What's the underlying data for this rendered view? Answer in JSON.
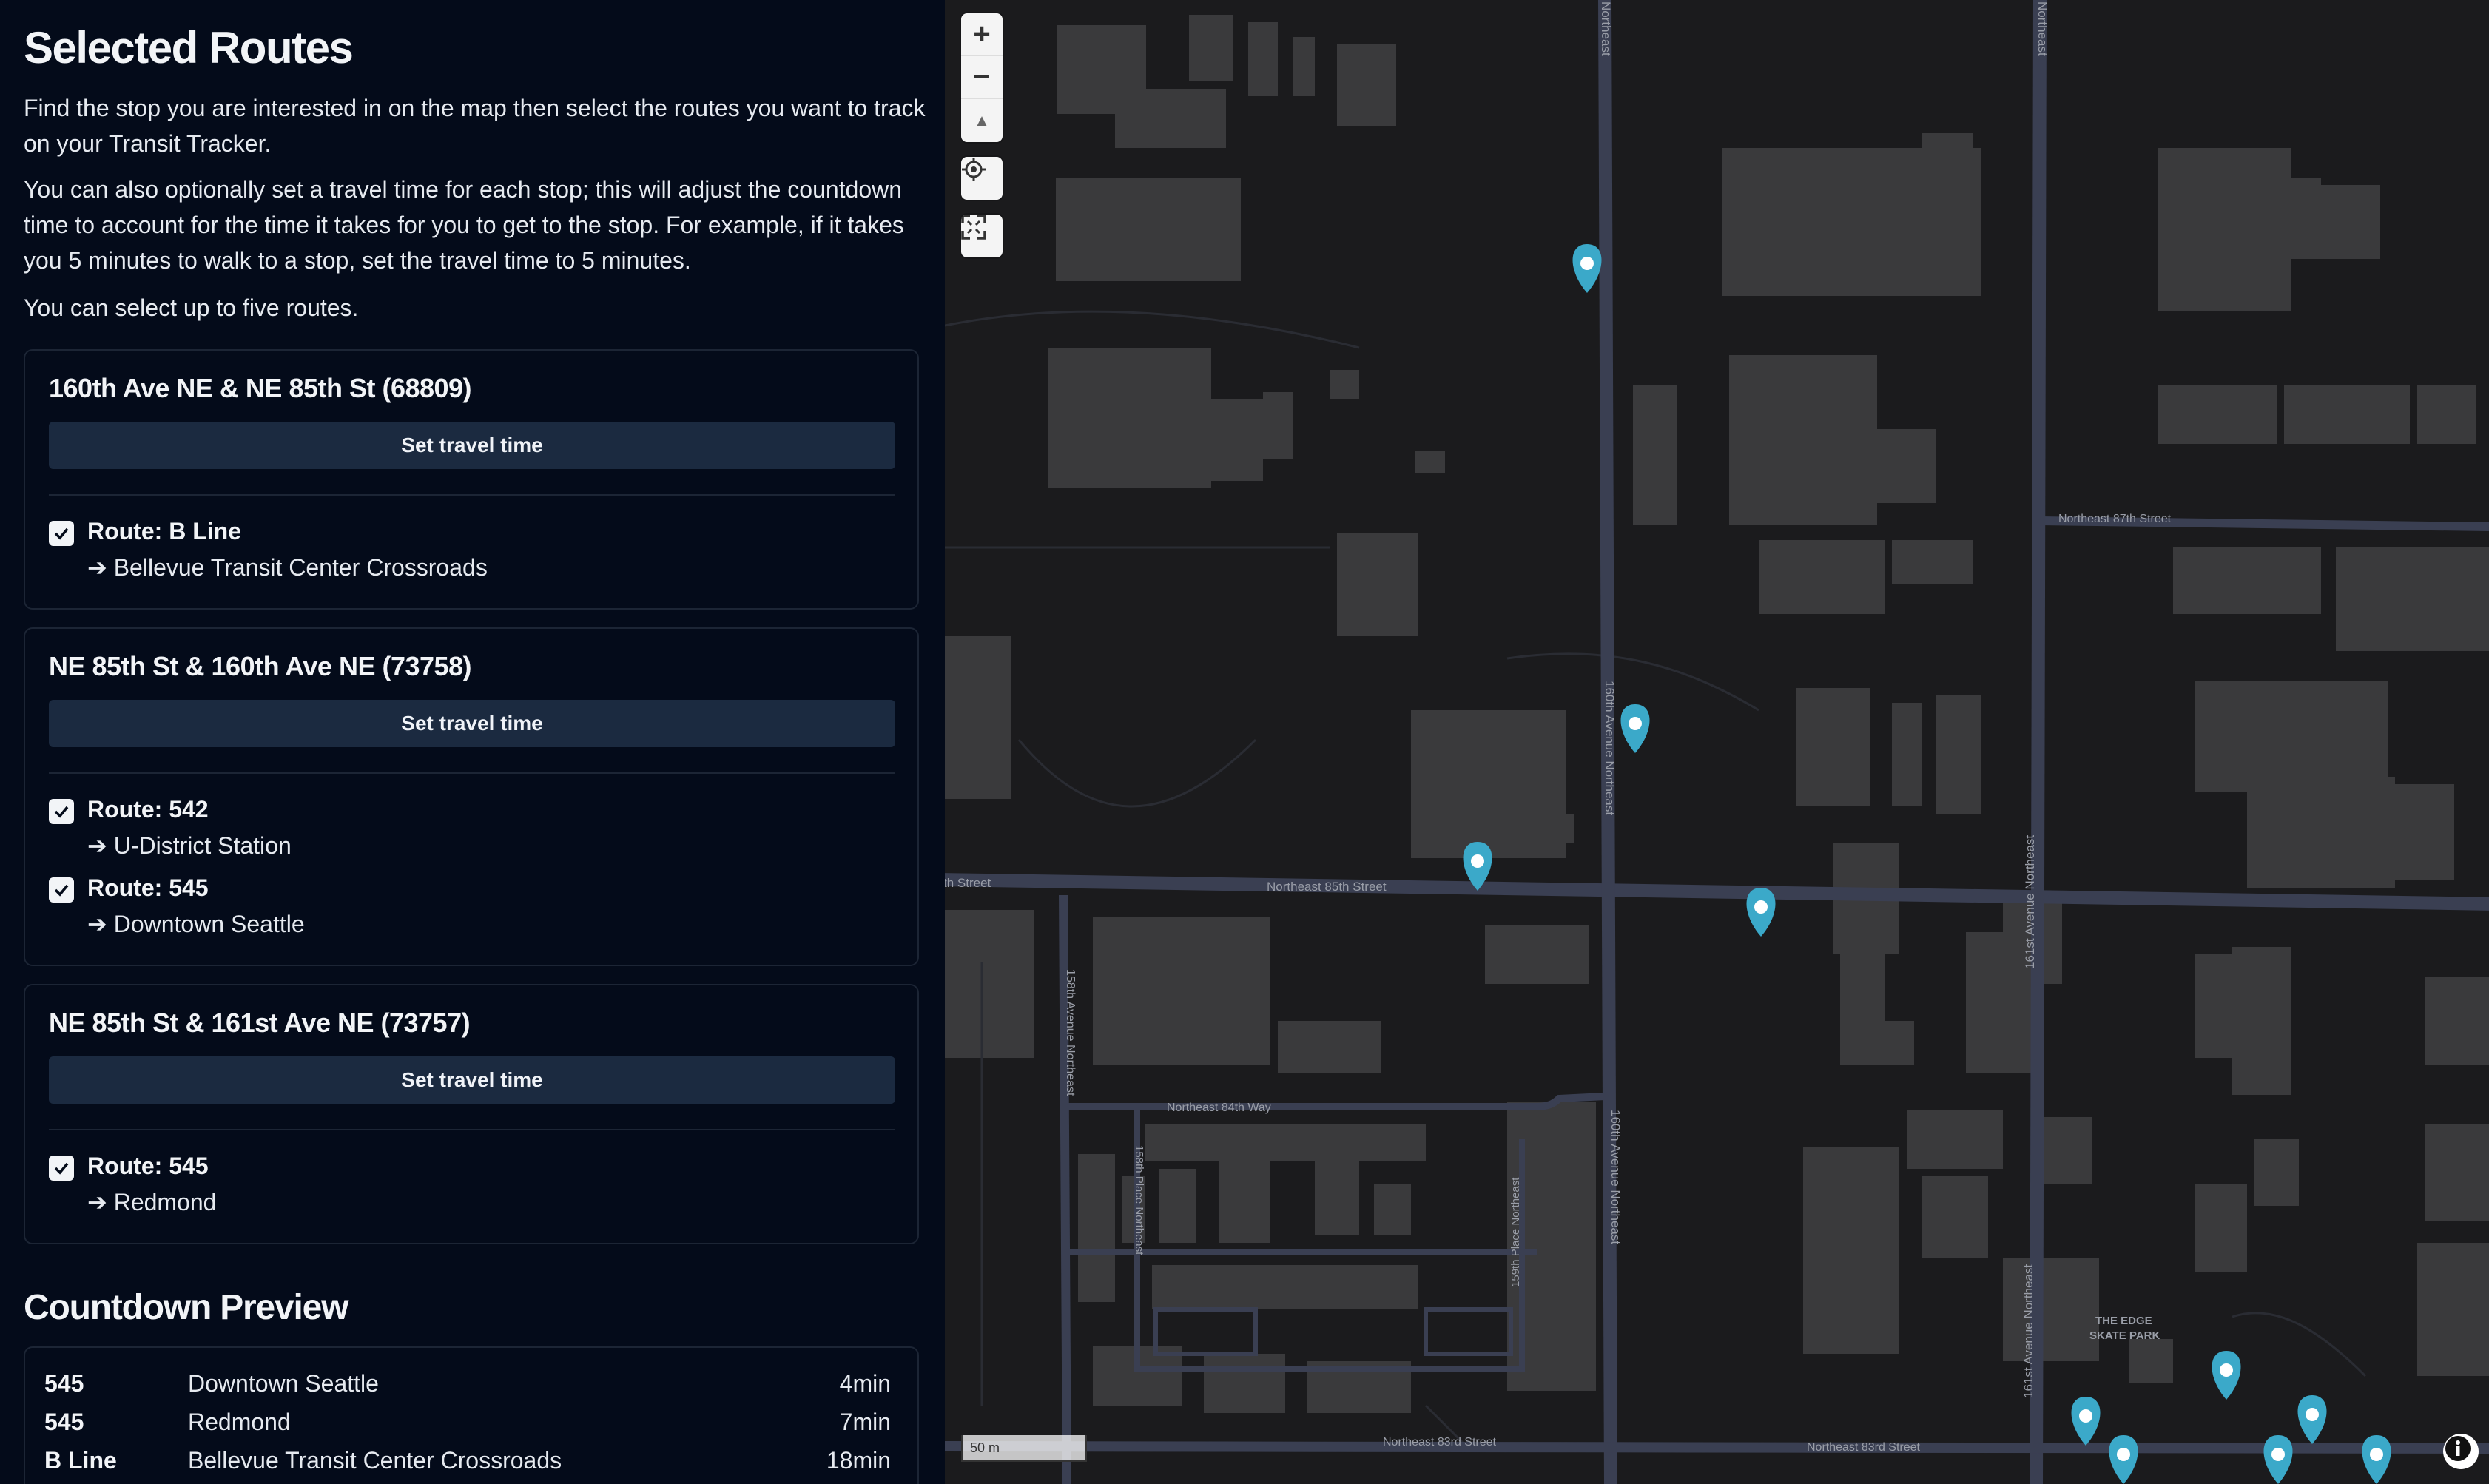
{
  "panel": {
    "title": "Selected Routes",
    "paragraphs": [
      "Find the stop you are interested in on the map then select the routes you want to track on your Transit Tracker.",
      "You can also optionally set a travel time for each stop; this will adjust the countdown time to account for the time it takes for you to get to the stop. For example, if it takes you 5 minutes to walk to a stop, set the travel time to 5 minutes.",
      "You can select up to five routes."
    ],
    "stops": [
      {
        "name": "160th Ave NE & NE 85th St (68809)",
        "button": "Set travel time",
        "routes": [
          {
            "label": "Route: B Line",
            "destination": "➔ Bellevue Transit Center Crossroads",
            "checked": true
          }
        ]
      },
      {
        "name": "NE 85th St & 160th Ave NE (73758)",
        "button": "Set travel time",
        "routes": [
          {
            "label": "Route: 542",
            "destination": "➔ U-District Station",
            "checked": true
          },
          {
            "label": "Route: 545",
            "destination": "➔ Downtown Seattle",
            "checked": true
          }
        ]
      },
      {
        "name": "NE 85th St & 161st Ave NE (73757)",
        "button": "Set travel time",
        "routes": [
          {
            "label": "Route: 545",
            "destination": "➔ Redmond",
            "checked": true
          }
        ]
      }
    ],
    "preview_title": "Countdown Preview",
    "preview_rows": [
      {
        "route": "545",
        "destination": "Downtown Seattle",
        "time": "4min"
      },
      {
        "route": "545",
        "destination": "Redmond",
        "time": "7min"
      },
      {
        "route": "B Line",
        "destination": "Bellevue Transit Center Crossroads",
        "time": "18min"
      }
    ]
  },
  "map": {
    "controls": {
      "zoom_in": "+",
      "zoom_out": "−",
      "compass": "▲"
    },
    "scale": "50 m",
    "street_labels": {
      "ne85": "Northeast 85th Street",
      "ne85_left": "th Street",
      "ne87": "Northeast 87th Street",
      "ne84way": "Northeast 84th Way",
      "ne83": "Northeast 83rd Street",
      "ne83b": "Northeast 83rd Street",
      "ave160": "160th Avenue Northeast",
      "ave160b": "160th Avenue Northeast",
      "ave161": "161st Avenue Northeast",
      "ave161b": "161st Avenue Northeast",
      "ave158": "158th Avenue Northeast",
      "place158": "158th Place Northeast",
      "place159": "159th Place Northeast",
      "ne_top1": "Northeast",
      "ne_top2": "Northeast"
    },
    "poi": {
      "line1": "THE EDGE",
      "line2": "SKATE PARK"
    },
    "colors": {
      "marker": "#3ba9c9",
      "road": "#3a3f52",
      "building": "#3a3a3c",
      "background": "#1b1b1d"
    }
  }
}
